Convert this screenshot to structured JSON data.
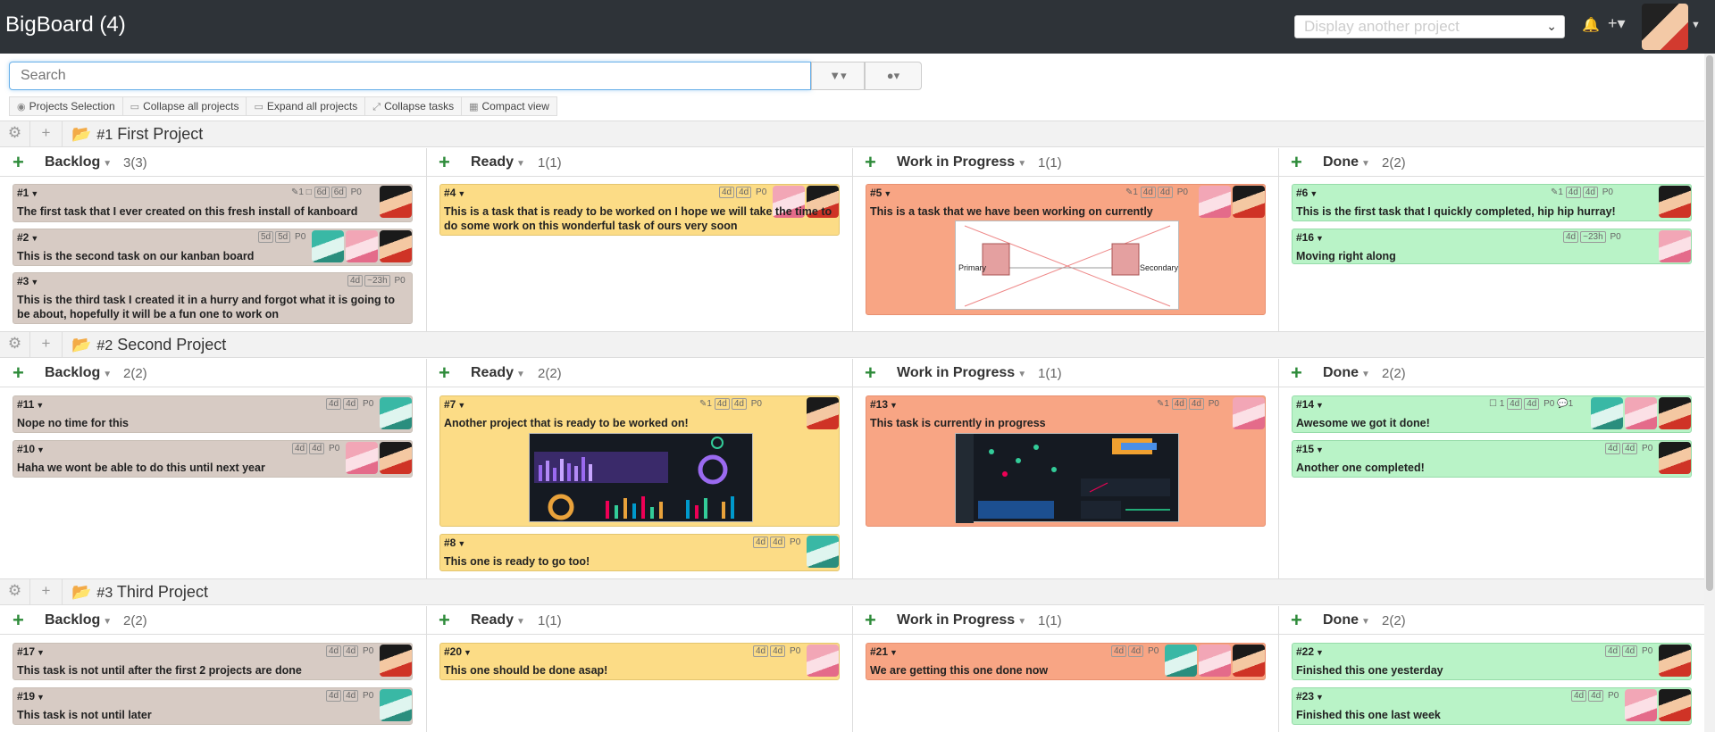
{
  "app": {
    "title": "BigBoard (4)",
    "project_select_placeholder": "Display another project"
  },
  "search": {
    "placeholder": "Search"
  },
  "toolbar": {
    "projects_selection": "Projects Selection",
    "collapse_all": "Collapse all projects",
    "expand_all": "Expand all projects",
    "collapse_tasks": "Collapse tasks",
    "compact_view": "Compact view"
  },
  "colors": {
    "backlog": "#d7cbc4",
    "ready": "#fcdc86",
    "wip": "#f8a584",
    "done": "#b9f3c7",
    "topbar": "#2e3338",
    "add_green": "#2e8b3a"
  },
  "projects": [
    {
      "num": "#1",
      "name": "First Project",
      "columns": [
        {
          "name": "Backlog",
          "count": "3(3)"
        },
        {
          "name": "Ready",
          "count": "1(1)"
        },
        {
          "name": "Work in Progress",
          "count": "1(1)"
        },
        {
          "name": "Done",
          "count": "2(2)"
        }
      ],
      "cards": {
        "c1": {
          "id": "#1",
          "title": "The first task that I ever created on this fresh install of kanboard",
          "meta1": "1",
          "meta2": "6d",
          "meta3": "6d",
          "priority": "P0"
        },
        "c2": {
          "id": "#2",
          "title": "This is the second task on our kanban board",
          "meta2": "5d",
          "meta3": "5d",
          "priority": "P0"
        },
        "c3": {
          "id": "#3",
          "title": "This is the third task I created it in a hurry and forgot what it is going to be about, hopefully it will be a fun one to work on",
          "meta2": "4d",
          "meta3": "~23h",
          "priority": "P0"
        },
        "c4": {
          "id": "#4",
          "title": "This is a task that is ready to be worked on I hope we will take the time to do some work on this wonderful task of ours very soon",
          "meta2": "4d",
          "meta3": "4d",
          "priority": "P0"
        },
        "c5": {
          "id": "#5",
          "title": "This is a task that we have been working on currently",
          "meta1": "1",
          "meta2": "4d",
          "meta3": "4d",
          "priority": "P0"
        },
        "c6": {
          "id": "#6",
          "title": "This is the first task that I quickly completed, hip hip hurray!",
          "meta1": "1",
          "meta2": "4d",
          "meta3": "4d",
          "priority": "P0"
        },
        "c16": {
          "id": "#16",
          "title": "Moving right along",
          "meta2": "4d",
          "meta3": "~23h",
          "priority": "P0"
        }
      }
    },
    {
      "num": "#2",
      "name": "Second Project",
      "columns": [
        {
          "name": "Backlog",
          "count": "2(2)"
        },
        {
          "name": "Ready",
          "count": "2(2)"
        },
        {
          "name": "Work in Progress",
          "count": "1(1)"
        },
        {
          "name": "Done",
          "count": "2(2)"
        }
      ],
      "cards": {
        "c11": {
          "id": "#11",
          "title": "Nope no time for this",
          "meta2": "4d",
          "meta3": "4d",
          "priority": "P0"
        },
        "c10": {
          "id": "#10",
          "title": "Haha we wont be able to do this until next year",
          "meta2": "4d",
          "meta3": "4d",
          "priority": "P0"
        },
        "c7": {
          "id": "#7",
          "title": "Another project that is ready to be worked on!",
          "meta1": "1",
          "meta2": "4d",
          "meta3": "4d",
          "priority": "P0"
        },
        "c8": {
          "id": "#8",
          "title": "This one is ready to go too!",
          "meta2": "4d",
          "meta3": "4d",
          "priority": "P0"
        },
        "c13": {
          "id": "#13",
          "title": "This task is currently in progress",
          "meta1": "1",
          "meta2": "4d",
          "meta3": "4d",
          "priority": "P0"
        },
        "c14": {
          "id": "#14",
          "title": "Awesome we got it done!",
          "meta1": "1",
          "meta2": "4d",
          "meta3": "4d",
          "priority": "P0",
          "comments": "1"
        },
        "c15": {
          "id": "#15",
          "title": "Another one completed!",
          "meta2": "4d",
          "meta3": "4d",
          "priority": "P0"
        }
      }
    },
    {
      "num": "#3",
      "name": "Third Project",
      "columns": [
        {
          "name": "Backlog",
          "count": "2(2)"
        },
        {
          "name": "Ready",
          "count": "1(1)"
        },
        {
          "name": "Work in Progress",
          "count": "1(1)"
        },
        {
          "name": "Done",
          "count": "2(2)"
        }
      ],
      "cards": {
        "c17": {
          "id": "#17",
          "title": "This task is not until after the first 2 projects are done",
          "meta2": "4d",
          "meta3": "4d",
          "priority": "P0"
        },
        "c19": {
          "id": "#19",
          "title": "This task is not until later",
          "meta2": "4d",
          "meta3": "4d",
          "priority": "P0"
        },
        "c20": {
          "id": "#20",
          "title": "This one should be done asap!",
          "meta2": "4d",
          "meta3": "4d",
          "priority": "P0"
        },
        "c21": {
          "id": "#21",
          "title": "We are getting this one done now",
          "meta2": "4d",
          "meta3": "4d",
          "priority": "P0"
        },
        "c22": {
          "id": "#22",
          "title": "Finished this one yesterday",
          "meta2": "4d",
          "meta3": "4d",
          "priority": "P0"
        },
        "c23": {
          "id": "#23",
          "title": "Finished this one last week",
          "meta2": "4d",
          "meta3": "4d",
          "priority": "P0"
        }
      }
    }
  ],
  "network_labels": {
    "primary": "Primary",
    "secondary": "Secondary"
  }
}
